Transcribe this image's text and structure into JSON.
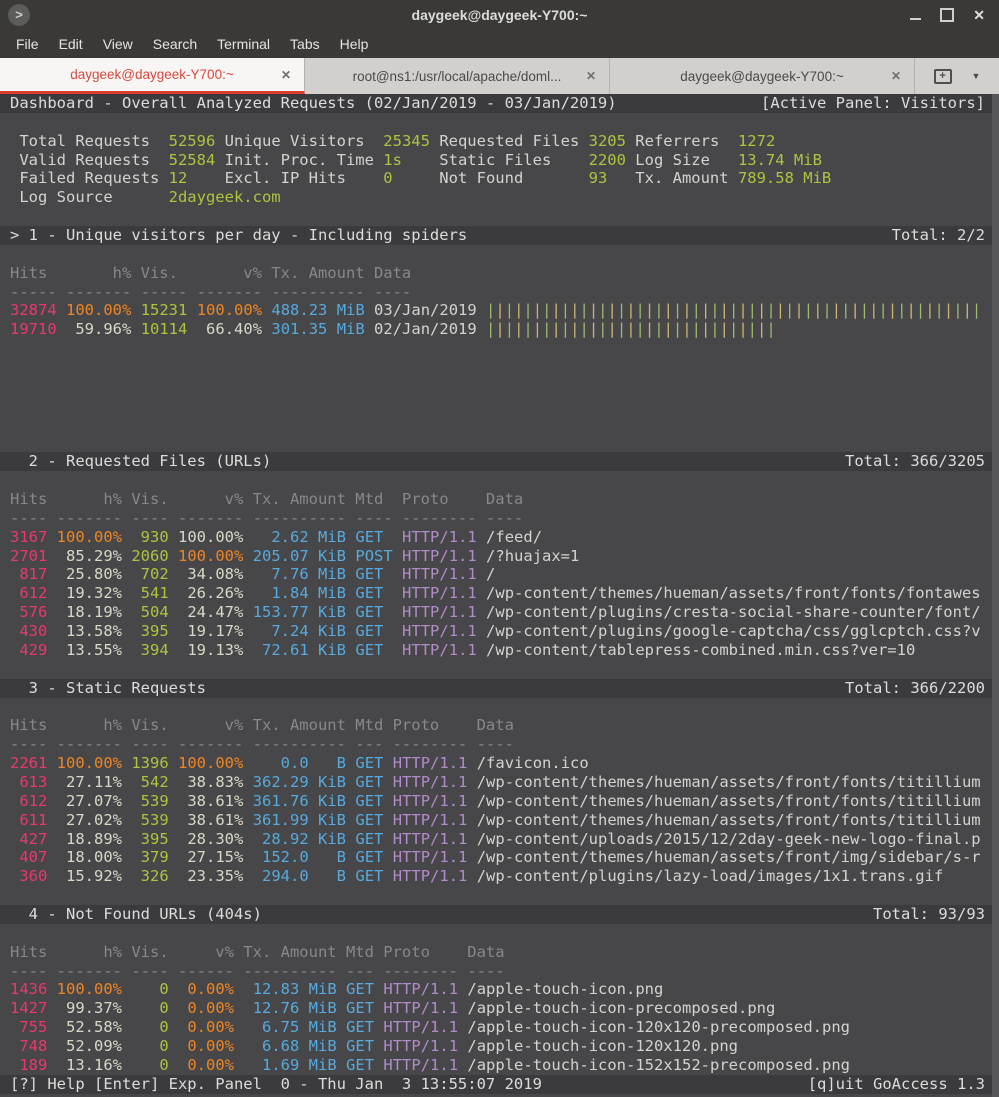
{
  "window": {
    "title": "daygeek@daygeek-Y700:~",
    "icon_glyph": ">",
    "close_glyph": "✕"
  },
  "menu": {
    "items": [
      "File",
      "Edit",
      "View",
      "Search",
      "Terminal",
      "Tabs",
      "Help"
    ]
  },
  "tabs": {
    "close_glyph": "✕",
    "new_tab_glyph": "+",
    "dropdown_glyph": "▼",
    "items": [
      {
        "label": "daygeek@daygeek-Y700:~",
        "active": true
      },
      {
        "label": "root@ns1:/usr/local/apache/doml...",
        "active": false
      },
      {
        "label": "daygeek@daygeek-Y700:~",
        "active": false
      }
    ]
  },
  "colors": {
    "terminal_bg": "#47474a",
    "panel_bar_bg": "#3b3b3e",
    "hits": "#e9396b",
    "highlight": "#ef8522",
    "visitors": "#adc53c",
    "size": "#56aadd",
    "protocol": "#b28bc9",
    "text": "#d3d3d0",
    "bar_green": "#9cb96d",
    "bar_tan": "#cbb46f",
    "tab_accent": "#e13b30"
  },
  "dashboard_bar": {
    "left": "Dashboard - Overall Analyzed Requests (02/Jan/2019 - 03/Jan/2019)",
    "right": "[Active Panel: Visitors]"
  },
  "summary_lines": [
    [
      {
        "t": " Total Requests  ",
        "c": "fg"
      },
      {
        "t": "52596",
        "c": "green"
      },
      {
        "t": " ",
        "c": "fg"
      },
      {
        "t": "Unique Visitors  ",
        "c": "fg"
      },
      {
        "t": "25345",
        "c": "green"
      },
      {
        "t": " ",
        "c": "fg"
      },
      {
        "t": "Requested Files ",
        "c": "fg"
      },
      {
        "t": "3205",
        "c": "green"
      },
      {
        "t": " ",
        "c": "fg"
      },
      {
        "t": "Referrers  ",
        "c": "fg"
      },
      {
        "t": "1272",
        "c": "green"
      }
    ],
    [
      {
        "t": " Valid Requests  ",
        "c": "fg"
      },
      {
        "t": "52584",
        "c": "green"
      },
      {
        "t": " ",
        "c": "fg"
      },
      {
        "t": "Init. Proc. Time ",
        "c": "fg"
      },
      {
        "t": "1s",
        "c": "green"
      },
      {
        "t": "    ",
        "c": "fg"
      },
      {
        "t": "Static Files    ",
        "c": "fg"
      },
      {
        "t": "2200",
        "c": "green"
      },
      {
        "t": " ",
        "c": "fg"
      },
      {
        "t": "Log Size   ",
        "c": "fg"
      },
      {
        "t": "13.74 MiB",
        "c": "green"
      }
    ],
    [
      {
        "t": " Failed Requests ",
        "c": "fg"
      },
      {
        "t": "12",
        "c": "green"
      },
      {
        "t": "    ",
        "c": "fg"
      },
      {
        "t": "Excl. IP Hits    ",
        "c": "fg"
      },
      {
        "t": "0",
        "c": "green"
      },
      {
        "t": "     ",
        "c": "fg"
      },
      {
        "t": "Not Found       ",
        "c": "fg"
      },
      {
        "t": "93",
        "c": "green"
      },
      {
        "t": "   ",
        "c": "fg"
      },
      {
        "t": "Tx. Amount ",
        "c": "fg"
      },
      {
        "t": "789.58 MiB",
        "c": "green"
      }
    ],
    [
      {
        "t": " Log Source      ",
        "c": "fg"
      },
      {
        "t": "2daygeek.com",
        "c": "green"
      }
    ]
  ],
  "panels": [
    {
      "title": "> 1 - Unique visitors per day - Including spiders",
      "total": "Total: 2/2",
      "active": true,
      "blank_after": 6,
      "columns": [
        {
          "key": "hits",
          "label": "Hits",
          "w": 5,
          "head": "L"
        },
        {
          "key": "hpct",
          "label": "h%",
          "w": 7,
          "head": "R"
        },
        {
          "key": "vis",
          "label": "Vis.",
          "w": 5,
          "head": "L"
        },
        {
          "key": "vpct",
          "label": "v%",
          "w": 7,
          "head": "R"
        },
        {
          "key": "tx",
          "label": "Tx. Amount",
          "w": 10,
          "head": "L"
        },
        {
          "key": "data",
          "label": "Data",
          "w": 4,
          "head": "L",
          "last": true
        }
      ],
      "rows": [
        {
          "hits": "32874",
          "hpct": "100.00%",
          "hpct_hl": true,
          "vis": "15231",
          "vpct": "100.00%",
          "vpct_hl": true,
          "tx_val": "488.23",
          "tx_unit": "MiB",
          "data": "03/Jan/2019",
          "bars": 53
        },
        {
          "hits": "19710",
          "hpct": "59.96%",
          "hpct_hl": false,
          "vis": "10114",
          "vpct": "66.40%",
          "vpct_hl": false,
          "tx_val": "301.35",
          "tx_unit": "MiB",
          "data": "02/Jan/2019",
          "bars": 31
        }
      ]
    },
    {
      "title": "  2 - Requested Files (URLs)",
      "total": "Total: 366/3205",
      "active": false,
      "blank_after": 1,
      "columns": [
        {
          "key": "hits",
          "label": "Hits",
          "w": 4,
          "head": "L"
        },
        {
          "key": "hpct",
          "label": "h%",
          "w": 7,
          "head": "R"
        },
        {
          "key": "vis",
          "label": "Vis.",
          "w": 4,
          "head": "L"
        },
        {
          "key": "vpct",
          "label": "v%",
          "w": 7,
          "head": "R"
        },
        {
          "key": "tx",
          "label": "Tx. Amount",
          "w": 10,
          "head": "L"
        },
        {
          "key": "mtd",
          "label": "Mtd",
          "w": 4,
          "head": "L"
        },
        {
          "key": "proto",
          "label": "Proto",
          "w": 8,
          "head": "L"
        },
        {
          "key": "data",
          "label": "Data",
          "w": 4,
          "head": "L",
          "last": true
        }
      ],
      "rows": [
        {
          "hits": "3167",
          "hpct": "100.00%",
          "hpct_hl": true,
          "vis": "930",
          "vpct": "100.00%",
          "vpct_hl": false,
          "tx_val": "2.62",
          "tx_unit": "MiB",
          "mtd": "GET",
          "proto": "HTTP/1.1",
          "data": "/feed/"
        },
        {
          "hits": "2701",
          "hpct": "85.29%",
          "hpct_hl": false,
          "vis": "2060",
          "vpct": "100.00%",
          "vpct_hl": true,
          "tx_val": "205.07",
          "tx_unit": "KiB",
          "mtd": "POST",
          "proto": "HTTP/1.1",
          "data": "/?huajax=1"
        },
        {
          "hits": "817",
          "hpct": "25.80%",
          "hpct_hl": false,
          "vis": "702",
          "vpct": "34.08%",
          "vpct_hl": false,
          "tx_val": "7.76",
          "tx_unit": "MiB",
          "mtd": "GET",
          "proto": "HTTP/1.1",
          "data": "/"
        },
        {
          "hits": "612",
          "hpct": "19.32%",
          "hpct_hl": false,
          "vis": "541",
          "vpct": "26.26%",
          "vpct_hl": false,
          "tx_val": "1.84",
          "tx_unit": "MiB",
          "mtd": "GET",
          "proto": "HTTP/1.1",
          "data": "/wp-content/themes/hueman/assets/front/fonts/fontawes"
        },
        {
          "hits": "576",
          "hpct": "18.19%",
          "hpct_hl": false,
          "vis": "504",
          "vpct": "24.47%",
          "vpct_hl": false,
          "tx_val": "153.77",
          "tx_unit": "KiB",
          "mtd": "GET",
          "proto": "HTTP/1.1",
          "data": "/wp-content/plugins/cresta-social-share-counter/font/"
        },
        {
          "hits": "430",
          "hpct": "13.58%",
          "hpct_hl": false,
          "vis": "395",
          "vpct": "19.17%",
          "vpct_hl": false,
          "tx_val": "7.24",
          "tx_unit": "KiB",
          "mtd": "GET",
          "proto": "HTTP/1.1",
          "data": "/wp-content/plugins/google-captcha/css/gglcptch.css?v"
        },
        {
          "hits": "429",
          "hpct": "13.55%",
          "hpct_hl": false,
          "vis": "394",
          "vpct": "19.13%",
          "vpct_hl": false,
          "tx_val": "72.61",
          "tx_unit": "KiB",
          "mtd": "GET",
          "proto": "HTTP/1.1",
          "data": "/wp-content/tablepress-combined.min.css?ver=10"
        }
      ]
    },
    {
      "title": "  3 - Static Requests",
      "total": "Total: 366/2200",
      "active": false,
      "blank_after": 1,
      "columns": [
        {
          "key": "hits",
          "label": "Hits",
          "w": 4,
          "head": "L"
        },
        {
          "key": "hpct",
          "label": "h%",
          "w": 7,
          "head": "R"
        },
        {
          "key": "vis",
          "label": "Vis.",
          "w": 4,
          "head": "L"
        },
        {
          "key": "vpct",
          "label": "v%",
          "w": 7,
          "head": "R"
        },
        {
          "key": "tx",
          "label": "Tx. Amount",
          "w": 10,
          "head": "L"
        },
        {
          "key": "mtd",
          "label": "Mtd",
          "w": 3,
          "head": "L"
        },
        {
          "key": "proto",
          "label": "Proto",
          "w": 8,
          "head": "L"
        },
        {
          "key": "data",
          "label": "Data",
          "w": 4,
          "head": "L",
          "last": true
        }
      ],
      "rows": [
        {
          "hits": "2261",
          "hpct": "100.00%",
          "hpct_hl": true,
          "vis": "1396",
          "vpct": "100.00%",
          "vpct_hl": true,
          "tx_val": "0.0",
          "tx_unit": "B",
          "mtd": "GET",
          "proto": "HTTP/1.1",
          "data": "/favicon.ico"
        },
        {
          "hits": "613",
          "hpct": "27.11%",
          "hpct_hl": false,
          "vis": "542",
          "vpct": "38.83%",
          "vpct_hl": false,
          "tx_val": "362.29",
          "tx_unit": "KiB",
          "mtd": "GET",
          "proto": "HTTP/1.1",
          "data": "/wp-content/themes/hueman/assets/front/fonts/titillium"
        },
        {
          "hits": "612",
          "hpct": "27.07%",
          "hpct_hl": false,
          "vis": "539",
          "vpct": "38.61%",
          "vpct_hl": false,
          "tx_val": "361.76",
          "tx_unit": "KiB",
          "mtd": "GET",
          "proto": "HTTP/1.1",
          "data": "/wp-content/themes/hueman/assets/front/fonts/titillium"
        },
        {
          "hits": "611",
          "hpct": "27.02%",
          "hpct_hl": false,
          "vis": "539",
          "vpct": "38.61%",
          "vpct_hl": false,
          "tx_val": "361.99",
          "tx_unit": "KiB",
          "mtd": "GET",
          "proto": "HTTP/1.1",
          "data": "/wp-content/themes/hueman/assets/front/fonts/titillium"
        },
        {
          "hits": "427",
          "hpct": "18.89%",
          "hpct_hl": false,
          "vis": "395",
          "vpct": "28.30%",
          "vpct_hl": false,
          "tx_val": "28.92",
          "tx_unit": "KiB",
          "mtd": "GET",
          "proto": "HTTP/1.1",
          "data": "/wp-content/uploads/2015/12/2day-geek-new-logo-final.p"
        },
        {
          "hits": "407",
          "hpct": "18.00%",
          "hpct_hl": false,
          "vis": "379",
          "vpct": "27.15%",
          "vpct_hl": false,
          "tx_val": "152.0",
          "tx_unit": "B",
          "mtd": "GET",
          "proto": "HTTP/1.1",
          "data": "/wp-content/themes/hueman/assets/front/img/sidebar/s-r"
        },
        {
          "hits": "360",
          "hpct": "15.92%",
          "hpct_hl": false,
          "vis": "326",
          "vpct": "23.35%",
          "vpct_hl": false,
          "tx_val": "294.0",
          "tx_unit": "B",
          "mtd": "GET",
          "proto": "HTTP/1.1",
          "data": "/wp-content/plugins/lazy-load/images/1x1.trans.gif"
        }
      ]
    },
    {
      "title": "  4 - Not Found URLs (404s)",
      "total": "Total: 93/93",
      "active": false,
      "blank_after": 0,
      "columns": [
        {
          "key": "hits",
          "label": "Hits",
          "w": 4,
          "head": "L"
        },
        {
          "key": "hpct",
          "label": "h%",
          "w": 7,
          "head": "R"
        },
        {
          "key": "vis",
          "label": "Vis.",
          "w": 4,
          "head": "L"
        },
        {
          "key": "vpct",
          "label": "v%",
          "w": 6,
          "head": "R"
        },
        {
          "key": "tx",
          "label": "Tx. Amount",
          "w": 10,
          "head": "L"
        },
        {
          "key": "mtd",
          "label": "Mtd",
          "w": 3,
          "head": "L"
        },
        {
          "key": "proto",
          "label": "Proto",
          "w": 8,
          "head": "L"
        },
        {
          "key": "data",
          "label": "Data",
          "w": 4,
          "head": "L",
          "last": true
        }
      ],
      "rows": [
        {
          "hits": "1436",
          "hpct": "100.00%",
          "hpct_hl": true,
          "vis": "0",
          "vpct": "0.00%",
          "vpct_hl": true,
          "tx_val": "12.83",
          "tx_unit": "MiB",
          "mtd": "GET",
          "proto": "HTTP/1.1",
          "data": "/apple-touch-icon.png"
        },
        {
          "hits": "1427",
          "hpct": "99.37%",
          "hpct_hl": false,
          "vis": "0",
          "vpct": "0.00%",
          "vpct_hl": true,
          "tx_val": "12.76",
          "tx_unit": "MiB",
          "mtd": "GET",
          "proto": "HTTP/1.1",
          "data": "/apple-touch-icon-precomposed.png"
        },
        {
          "hits": "755",
          "hpct": "52.58%",
          "hpct_hl": false,
          "vis": "0",
          "vpct": "0.00%",
          "vpct_hl": true,
          "tx_val": "6.75",
          "tx_unit": "MiB",
          "mtd": "GET",
          "proto": "HTTP/1.1",
          "data": "/apple-touch-icon-120x120-precomposed.png"
        },
        {
          "hits": "748",
          "hpct": "52.09%",
          "hpct_hl": false,
          "vis": "0",
          "vpct": "0.00%",
          "vpct_hl": true,
          "tx_val": "6.68",
          "tx_unit": "MiB",
          "mtd": "GET",
          "proto": "HTTP/1.1",
          "data": "/apple-touch-icon-120x120.png"
        },
        {
          "hits": "189",
          "hpct": "13.16%",
          "hpct_hl": false,
          "vis": "0",
          "vpct": "0.00%",
          "vpct_hl": true,
          "tx_val": "1.69",
          "tx_unit": "MiB",
          "mtd": "GET",
          "proto": "HTTP/1.1",
          "data": "/apple-touch-icon-152x152-precomposed.png"
        }
      ]
    }
  ],
  "status_bar": {
    "left": "[?] Help [Enter] Exp. Panel  0 - Thu Jan  3 13:55:07 2019",
    "right": "[q]uit GoAccess 1.3"
  }
}
